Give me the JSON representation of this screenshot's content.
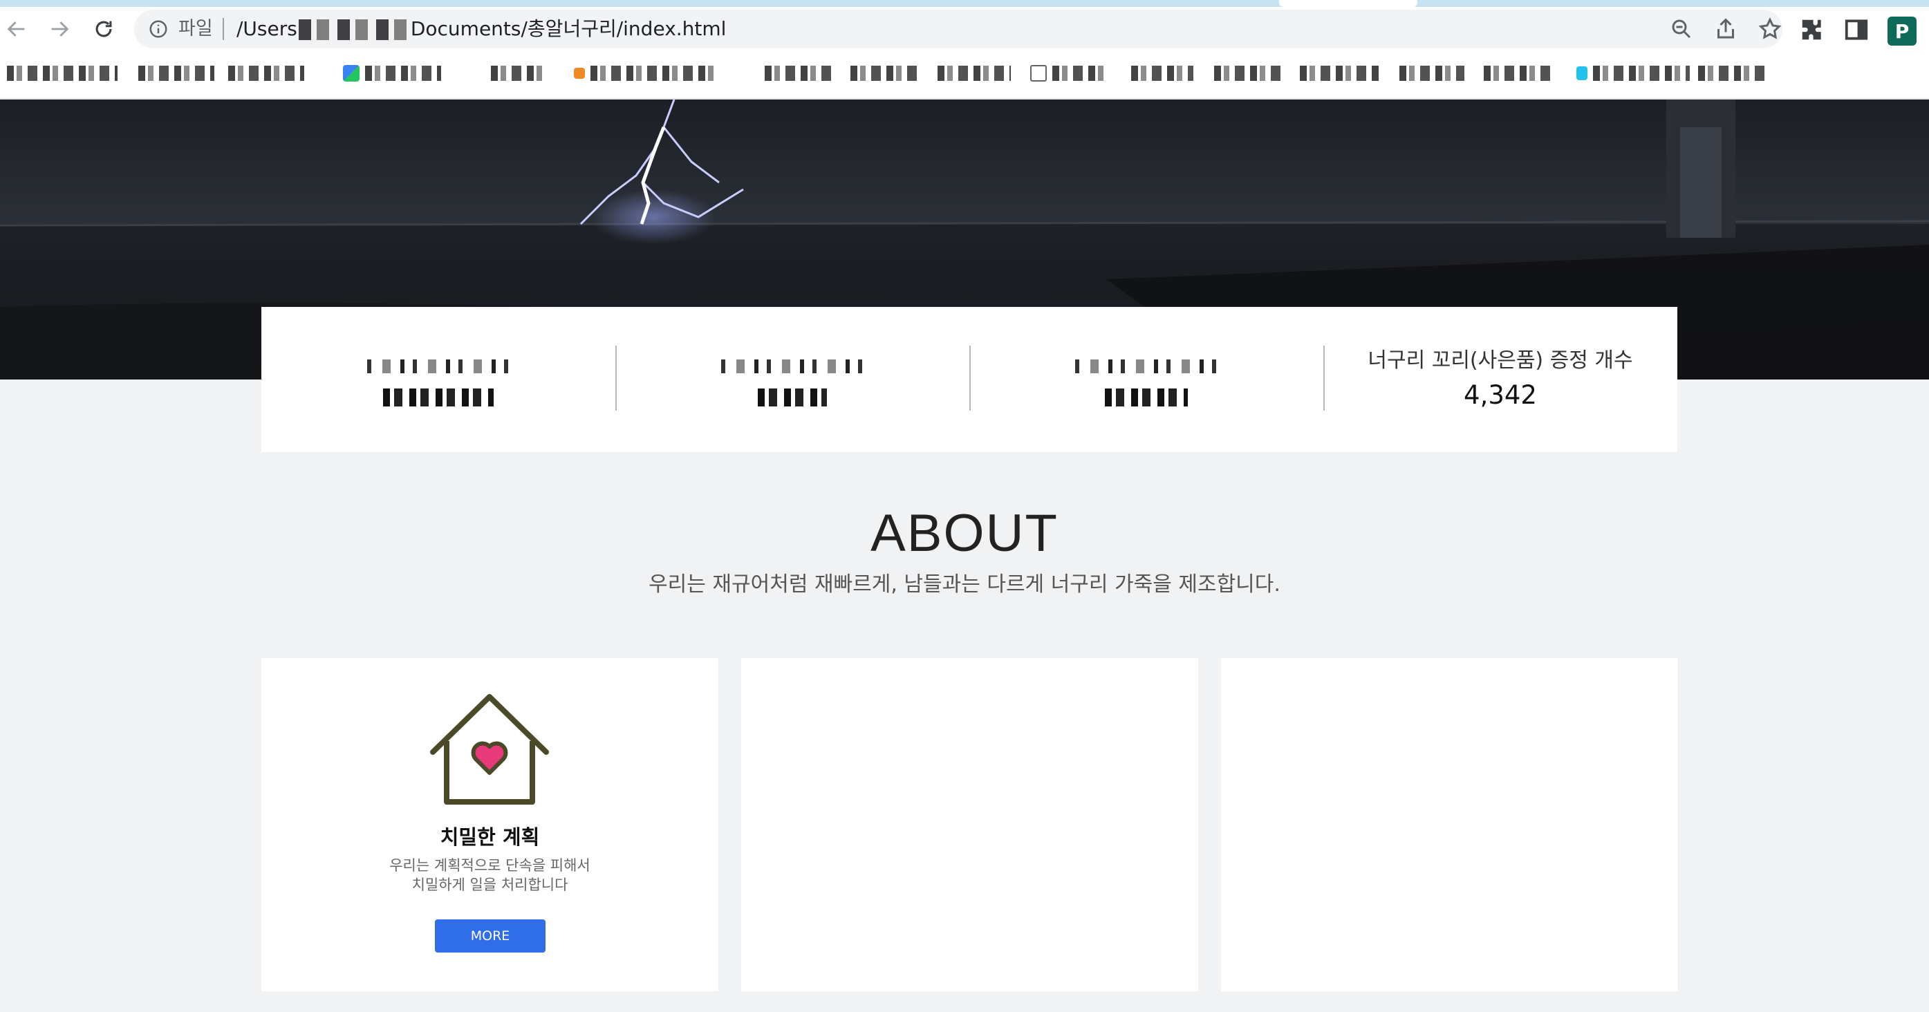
{
  "browser": {
    "scheme_label": "파일",
    "url_start": "/Users",
    "url_end": "Documents/총알너구리/index.html"
  },
  "stats": [
    {
      "label": "",
      "value": ""
    },
    {
      "label": "",
      "value": ""
    },
    {
      "label": "",
      "value": ""
    },
    {
      "label": "너구리 꼬리(사은품) 증정 개수",
      "value": "4,342"
    }
  ],
  "about": {
    "title": "ABOUT",
    "subtitle": "우리는 재규어처럼 재빠르게, 남들과는 다르게 너구리 가죽을 제조합니다."
  },
  "cards": [
    {
      "icon": "house-heart-icon",
      "title": "치밀한 계획",
      "desc_line1": "우리는 계획적으로 단속을 피해서",
      "desc_line2": "치밀하게 일을 처리합니다",
      "button": "MORE"
    }
  ],
  "colors": {
    "accent": "#2f6ee8",
    "icon_stroke": "#4a4a28",
    "heart": "#e8397a",
    "page_bg": "#f1f2f4"
  }
}
